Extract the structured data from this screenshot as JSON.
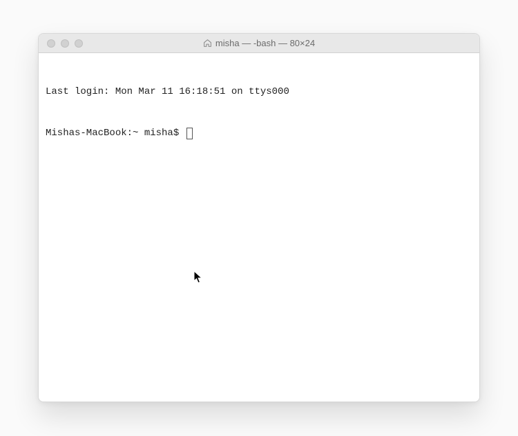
{
  "window": {
    "title": "misha — -bash — 80×24"
  },
  "terminal": {
    "last_login": "Last login: Mon Mar 11 16:18:51 on ttys000",
    "prompt": "Mishas-MacBook:~ misha$ "
  }
}
